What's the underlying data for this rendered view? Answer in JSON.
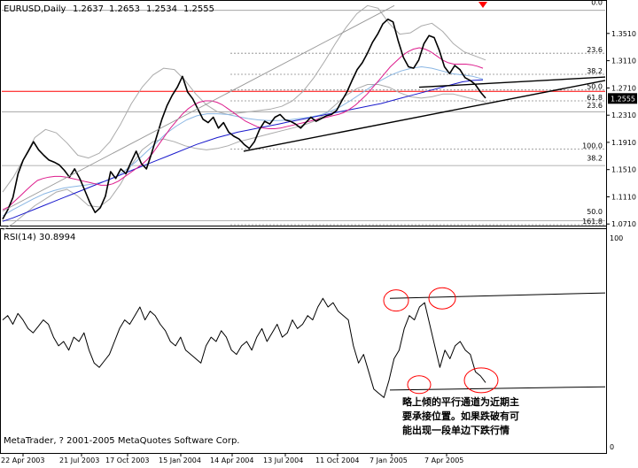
{
  "chart_data": {
    "type": "line",
    "title": "EURUSD,Daily",
    "ohlc": {
      "open": "1.2637",
      "high": "1.2653",
      "low": "1.2534",
      "close": "1.2555"
    },
    "price_axis": {
      "ylim": [
        1.07,
        1.395
      ],
      "ticks": [
        "1.3510",
        "1.3110",
        "1.2710",
        "1.2310",
        "1.1910",
        "1.1510",
        "1.1110",
        "1.0710"
      ],
      "current_price": "1.2555"
    },
    "x_axis": {
      "ticks": [
        "22 Apr 2003",
        "21 Jul 2003",
        "17 Oct 2003",
        "15 Jan 2004",
        "14 Apr 2004",
        "13 Jul 2004",
        "11 Oct 2004",
        "7 Jan 2005",
        "7 Apr 2005"
      ]
    },
    "series": [
      {
        "name": "EURUSD",
        "color": "#000000",
        "values": [
          1.078,
          1.092,
          1.11,
          1.145,
          1.165,
          1.178,
          1.192,
          1.18,
          1.172,
          1.165,
          1.162,
          1.158,
          1.15,
          1.14,
          1.152,
          1.138,
          1.12,
          1.102,
          1.088,
          1.095,
          1.112,
          1.148,
          1.138,
          1.152,
          1.145,
          1.162,
          1.178,
          1.16,
          1.152,
          1.175,
          1.2,
          1.225,
          1.245,
          1.26,
          1.272,
          1.288,
          1.265,
          1.255,
          1.24,
          1.225,
          1.22,
          1.228,
          1.212,
          1.22,
          1.206,
          1.2,
          1.196,
          1.188,
          1.182,
          1.192,
          1.21,
          1.222,
          1.218,
          1.228,
          1.232,
          1.224,
          1.222,
          1.218,
          1.212,
          1.22,
          1.228,
          1.222,
          1.226,
          1.23,
          1.232,
          1.238,
          1.252,
          1.265,
          1.282,
          1.298,
          1.308,
          1.322,
          1.338,
          1.35,
          1.365,
          1.372,
          1.368,
          1.34,
          1.316,
          1.302,
          1.3,
          1.312,
          1.336,
          1.348,
          1.345,
          1.326,
          1.302,
          1.292,
          1.304,
          1.298,
          1.286,
          1.282,
          1.276,
          1.265,
          1.256
        ]
      },
      {
        "name": "ma-pink",
        "color": "#dd1b8c",
        "values": [
          1.092,
          1.096,
          1.104,
          1.112,
          1.12,
          1.128,
          1.135,
          1.138,
          1.14,
          1.141,
          1.141,
          1.14,
          1.138,
          1.136,
          1.134,
          1.132,
          1.13,
          1.128,
          1.128,
          1.13,
          1.134,
          1.14,
          1.146,
          1.152,
          1.158,
          1.166,
          1.176,
          1.188,
          1.2,
          1.212,
          1.222,
          1.232,
          1.24,
          1.246,
          1.25,
          1.252,
          1.252,
          1.25,
          1.246,
          1.24,
          1.234,
          1.228,
          1.222,
          1.218,
          1.214,
          1.212,
          1.211,
          1.211,
          1.212,
          1.214,
          1.216,
          1.218,
          1.22,
          1.222,
          1.224,
          1.226,
          1.228,
          1.23,
          1.232,
          1.235,
          1.24,
          1.246,
          1.254,
          1.262,
          1.272,
          1.282,
          1.292,
          1.302,
          1.31,
          1.318,
          1.324,
          1.328,
          1.33,
          1.328,
          1.324,
          1.318,
          1.312,
          1.308,
          1.306,
          1.306,
          1.306,
          1.305,
          1.303,
          1.3
        ]
      },
      {
        "name": "ma-blue",
        "color": "#1a1acc",
        "values": [
          1.075,
          1.08,
          1.086,
          1.092,
          1.098,
          1.104,
          1.11,
          1.116,
          1.122,
          1.128,
          1.134,
          1.14,
          1.146,
          1.152,
          1.158,
          1.164,
          1.17,
          1.176,
          1.182,
          1.188,
          1.193,
          1.198,
          1.202,
          1.206,
          1.209,
          1.212,
          1.215,
          1.218,
          1.221,
          1.224,
          1.227,
          1.23,
          1.233,
          1.236,
          1.239,
          1.242,
          1.245,
          1.248,
          1.252,
          1.256,
          1.26,
          1.264,
          1.268,
          1.272,
          1.276,
          1.28,
          1.282,
          1.283
        ]
      },
      {
        "name": "ma-lightblue",
        "color": "#8ab6e3",
        "values": [
          1.083,
          1.092,
          1.1,
          1.108,
          1.115,
          1.12,
          1.124,
          1.126,
          1.128,
          1.13,
          1.134,
          1.14,
          1.15,
          1.162,
          1.176,
          1.19,
          1.204,
          1.215,
          1.224,
          1.23,
          1.233,
          1.233,
          1.232,
          1.229,
          1.226,
          1.224,
          1.223,
          1.223,
          1.224,
          1.226,
          1.228,
          1.231,
          1.236,
          1.243,
          1.252,
          1.262,
          1.272,
          1.282,
          1.29,
          1.296,
          1.3,
          1.302,
          1.3,
          1.296,
          1.292,
          1.29,
          1.288,
          1.284
        ]
      },
      {
        "name": "band-upper",
        "color": "#aaaaaa",
        "values": [
          1.118,
          1.14,
          1.168,
          1.198,
          1.21,
          1.205,
          1.19,
          1.172,
          1.168,
          1.175,
          1.192,
          1.218,
          1.248,
          1.272,
          1.29,
          1.3,
          1.298,
          1.282,
          1.262,
          1.246,
          1.236,
          1.232,
          1.234,
          1.236,
          1.238,
          1.24,
          1.244,
          1.252,
          1.266,
          1.286,
          1.31,
          1.336,
          1.36,
          1.38,
          1.392,
          1.388,
          1.366,
          1.35,
          1.352,
          1.362,
          1.366,
          1.354,
          1.336,
          1.324,
          1.318,
          1.312
        ]
      },
      {
        "name": "band-lower",
        "color": "#aaaaaa",
        "values": [
          1.062,
          1.072,
          1.085,
          1.098,
          1.108,
          1.118,
          1.122,
          1.112,
          1.098,
          1.096,
          1.108,
          1.13,
          1.158,
          1.18,
          1.192,
          1.196,
          1.192,
          1.186,
          1.182,
          1.18,
          1.182,
          1.186,
          1.192,
          1.196,
          1.2,
          1.204,
          1.208,
          1.212,
          1.216,
          1.222,
          1.232,
          1.246,
          1.26,
          1.27,
          1.276,
          1.276,
          1.272,
          1.264,
          1.258,
          1.256,
          1.258,
          1.262,
          1.262,
          1.258,
          1.254,
          1.25
        ]
      }
    ],
    "horizontal_lines": [
      {
        "value": 1.266,
        "color": "#ff0000"
      },
      {
        "value": 1.385,
        "color": "#999999"
      },
      {
        "value": 1.236,
        "color": "#999999"
      },
      {
        "value": 1.157,
        "color": "#999999"
      },
      {
        "value": 1.076,
        "color": "#999999"
      }
    ],
    "fib_levels": [
      {
        "label": "0.0",
        "value": 1.392,
        "major": true
      },
      {
        "label": "23.6",
        "value": 1.322,
        "major": false
      },
      {
        "label": "38.2",
        "value": 1.291,
        "major": false
      },
      {
        "label": "50.0",
        "value": 1.268,
        "major": false
      },
      {
        "label": "61.8",
        "value": 1.252,
        "major": false
      },
      {
        "label": "23.6",
        "value": 1.2405,
        "major": true
      },
      {
        "label": "100.0",
        "value": 1.181,
        "major": false
      },
      {
        "label": "38.2",
        "value": 1.163,
        "major": true
      },
      {
        "label": "50.0",
        "value": 1.084,
        "major": true
      },
      {
        "label": "161.8",
        "value": 1.07,
        "major": false
      }
    ],
    "rsi": {
      "title": "RSI(14) 30.8994",
      "ylim": [
        0,
        100
      ],
      "ticks": [
        "100",
        "0"
      ],
      "values": [
        60,
        62,
        58,
        63,
        60,
        56,
        54,
        57,
        60,
        58,
        52,
        48,
        50,
        46,
        52,
        50,
        54,
        46,
        40,
        38,
        41,
        44,
        50,
        56,
        60,
        58,
        62,
        66,
        60,
        64,
        62,
        58,
        55,
        50,
        48,
        52,
        46,
        44,
        42,
        40,
        48,
        52,
        50,
        55,
        52,
        46,
        44,
        48,
        50,
        46,
        52,
        56,
        50,
        54,
        58,
        52,
        54,
        60,
        56,
        58,
        62,
        60,
        66,
        70,
        66,
        68,
        64,
        62,
        60,
        48,
        40,
        44,
        36,
        28,
        26,
        24,
        32,
        42,
        46,
        56,
        62,
        60,
        66,
        68,
        58,
        48,
        38,
        46,
        42,
        48,
        50,
        46,
        44,
        36,
        34,
        31
      ]
    }
  },
  "annotation": "略上倾的平行通道为近期主要承接位置。如果跌破有可能出现一段单边下跌行情",
  "copyright": "MetaTrader, ? 2001-2005 MetaQuotes Software Corp."
}
